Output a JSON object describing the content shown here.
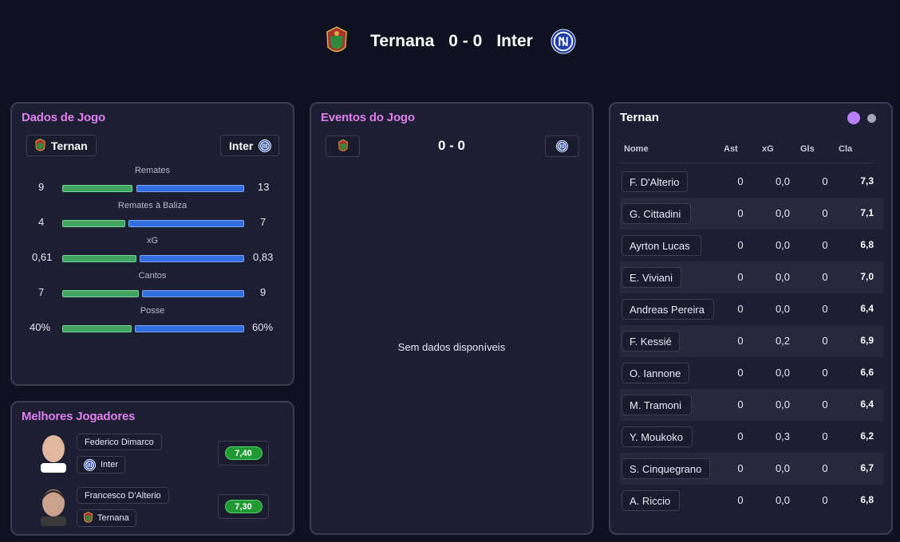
{
  "match": {
    "home_team": "Ternana",
    "away_team": "Inter",
    "score": "0 - 0"
  },
  "game_stats": {
    "title": "Dados de Jogo",
    "home_chip": "Ternan",
    "away_chip": "Inter",
    "stats": [
      {
        "label": "Remates",
        "home": "9",
        "away": "13"
      },
      {
        "label": "Remates à Baliza",
        "home": "4",
        "away": "7"
      },
      {
        "label": "xG",
        "home": "0,61",
        "away": "0,83"
      },
      {
        "label": "Cantos",
        "home": "7",
        "away": "9"
      },
      {
        "label": "Posse",
        "home": "40%",
        "away": "60%"
      }
    ]
  },
  "best_players": {
    "title": "Melhores Jogadores",
    "players": [
      {
        "name": "Federico Dimarco",
        "team": "Inter",
        "rating": "7,40"
      },
      {
        "name": "Francesco D'Alterio",
        "team": "Ternana",
        "rating": "7,30"
      }
    ]
  },
  "events": {
    "title": "Eventos do Jogo",
    "score": "0 - 0",
    "empty_text": "Sem dados disponíveis"
  },
  "lineup": {
    "title": "Ternan",
    "headers": {
      "name": "Nome",
      "ast": "Ast",
      "xg": "xG",
      "gls": "Gls",
      "cla": "Cla"
    },
    "rows": [
      {
        "name": "F. D'Alterio",
        "ast": "0",
        "xg": "0,0",
        "gls": "0",
        "cla": "7,3"
      },
      {
        "name": "G. Cittadini",
        "ast": "0",
        "xg": "0,0",
        "gls": "0",
        "cla": "7,1"
      },
      {
        "name": "Ayrton Lucas",
        "ast": "0",
        "xg": "0,0",
        "gls": "0",
        "cla": "6,8"
      },
      {
        "name": "E. Viviani",
        "ast": "0",
        "xg": "0,0",
        "gls": "0",
        "cla": "7,0"
      },
      {
        "name": "Andreas Pereira",
        "ast": "0",
        "xg": "0,0",
        "gls": "0",
        "cla": "6,4"
      },
      {
        "name": "F. Kessié",
        "ast": "0",
        "xg": "0,2",
        "gls": "0",
        "cla": "6,9"
      },
      {
        "name": "O. Iannone",
        "ast": "0",
        "xg": "0,0",
        "gls": "0",
        "cla": "6,6"
      },
      {
        "name": "M. Tramoni",
        "ast": "0",
        "xg": "0,0",
        "gls": "0",
        "cla": "6,4"
      },
      {
        "name": "Y. Moukoko",
        "ast": "0",
        "xg": "0,3",
        "gls": "0",
        "cla": "6,2"
      },
      {
        "name": "S. Cinquegrano",
        "ast": "0",
        "xg": "0,0",
        "gls": "0",
        "cla": "6,7"
      },
      {
        "name": "A. Riccio",
        "ast": "0",
        "xg": "0,0",
        "gls": "0",
        "cla": "6,8"
      }
    ]
  },
  "colors": {
    "accent_title": "#e07ef0",
    "home_bar": "#3fa45e",
    "away_bar": "#2f6de0",
    "rating_green": "#1f9a32"
  }
}
